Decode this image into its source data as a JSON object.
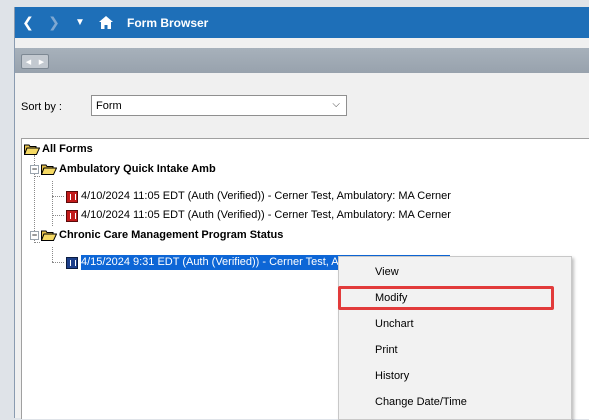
{
  "titlebar": {
    "title": "Form Browser",
    "back_icon": "chevron-left-icon",
    "forward_icon": "chevron-right-icon",
    "dropdown_icon": "caret-down-icon",
    "home_icon": "home-icon"
  },
  "sort": {
    "label": "Sort by :",
    "value": "Form"
  },
  "tree": {
    "root": "All Forms",
    "groups": [
      {
        "label": "Ambulatory Quick Intake Amb",
        "items": [
          "4/10/2024 11:05 EDT (Auth (Verified)) - Cerner Test, Ambulatory: MA Cerner",
          "4/10/2024 11:05 EDT (Auth (Verified)) - Cerner Test, Ambulatory: MA Cerner"
        ]
      },
      {
        "label": "Chronic Care Management Program Status",
        "items": [
          "4/15/2024 9:31 EDT (Auth (Verified)) - Cerner Test, Ambulatory: MA Cerner"
        ]
      }
    ]
  },
  "context_menu": {
    "items": [
      "View",
      "Modify",
      "Unchart",
      "Print",
      "History",
      "Change Date/Time"
    ]
  },
  "colors": {
    "titlebar": "#1e6fb8",
    "selection": "#0d66d6",
    "highlight": "#e23b3b",
    "doc_red": "#c21a1a",
    "doc_blue": "#1d3f8a"
  }
}
